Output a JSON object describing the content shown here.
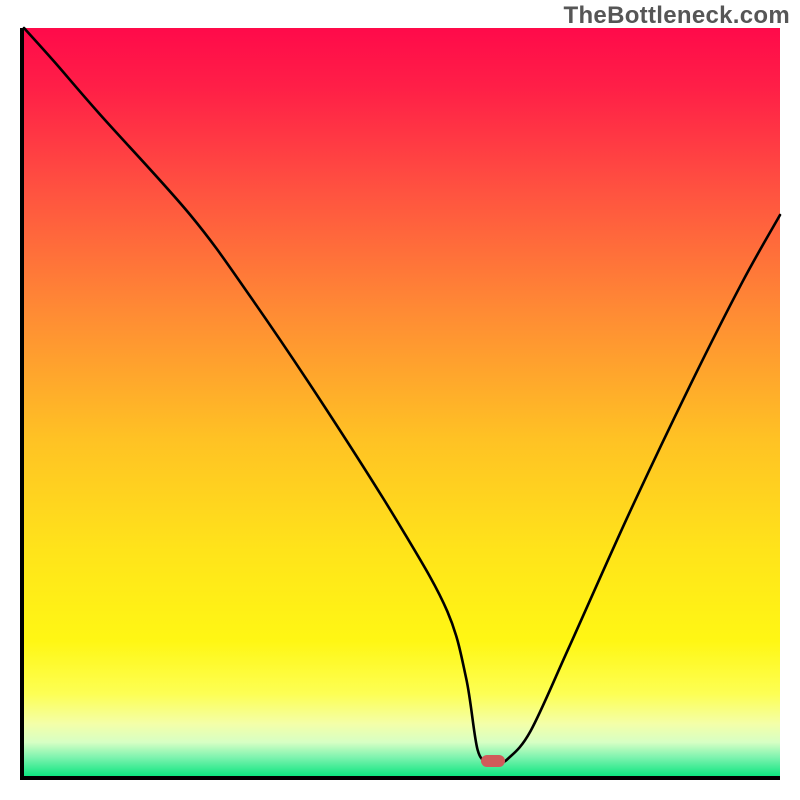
{
  "watermark": "TheBottleneck.com",
  "chart_data": {
    "type": "line",
    "title": "",
    "xlabel": "",
    "ylabel": "",
    "xlim": [
      0,
      100
    ],
    "ylim": [
      0,
      100
    ],
    "x": [
      0,
      4,
      10,
      22,
      30,
      40,
      50,
      56,
      58.5,
      60,
      61.5,
      63,
      64,
      67,
      72,
      80,
      88,
      95,
      100
    ],
    "y": [
      100,
      95.5,
      88.5,
      75,
      64,
      49,
      33,
      22,
      13,
      3.5,
      2,
      2,
      2.3,
      6,
      17,
      35,
      52,
      66,
      75
    ],
    "marker": {
      "x": 62,
      "y": 2,
      "color": "#d05a5a"
    },
    "gradient_id": "bottleneck-gradient"
  }
}
